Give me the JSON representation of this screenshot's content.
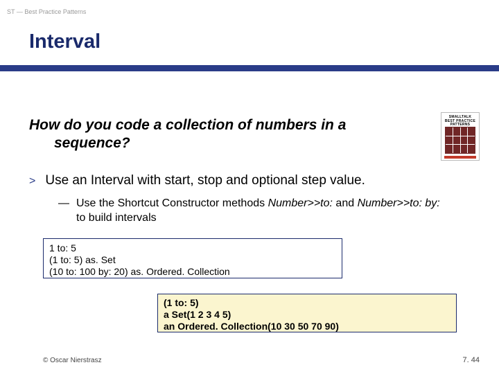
{
  "header": {
    "small": "ST — Best Practice Patterns",
    "title": "Interval"
  },
  "question": {
    "line1": "How do you code a collection of numbers in a",
    "line2": "sequence?"
  },
  "book": {
    "title_line1": "SMALLTALK",
    "title_line2": "BEST PRACTICE",
    "title_line3": "PATTERNS"
  },
  "bullet": {
    "marker": ">",
    "text": "Use an Interval with start, stop and optional step value."
  },
  "sub": {
    "marker": "—",
    "prefix": "Use the Shortcut Constructor methods ",
    "code1": "Number>>to:",
    "mid": " and ",
    "code2": "Number>>to: by:",
    "suffix": " to build intervals"
  },
  "code1": {
    "l1": "1 to: 5",
    "l2": "(1 to: 5) as. Set",
    "l3": "(10 to: 100 by: 20) as. Ordered. Collection"
  },
  "code2": {
    "l1": "(1 to: 5)",
    "l2": "a Set(1 2 3 4 5)",
    "l3": "an Ordered. Collection(10 30 50 70 90)"
  },
  "footer": {
    "left": "© Oscar Nierstrasz",
    "right": "7. 44"
  }
}
